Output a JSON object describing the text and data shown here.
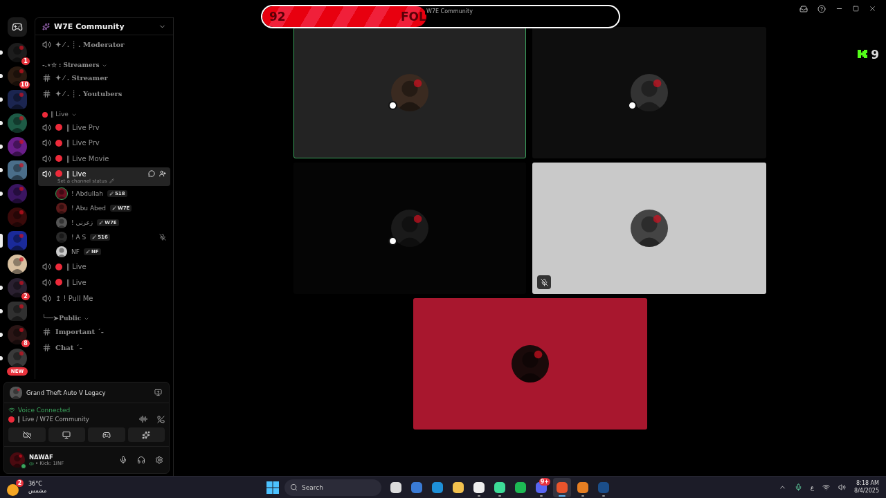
{
  "title_bar": {
    "title": "W7E Community"
  },
  "goal_bar": {
    "count": "92",
    "label": "FOL",
    "level": 0.46
  },
  "kick_overlay": {
    "count": "9"
  },
  "server_rail": {
    "servers": [
      {
        "badge": "1",
        "unread": true,
        "selected": false
      },
      {
        "badge": "10",
        "unread": true,
        "selected": false
      },
      {
        "unread": true,
        "selected": false
      },
      {
        "unread": true,
        "selected": false
      },
      {
        "unread": true,
        "selected": false
      },
      {
        "unread": true,
        "selected": false
      },
      {
        "unread": true,
        "selected": false
      },
      {
        "unread": false,
        "selected": false
      },
      {
        "unread": false,
        "selected": true
      },
      {
        "unread": false,
        "selected": false
      },
      {
        "badge": "2",
        "unread": true,
        "selected": false
      },
      {
        "unread": true,
        "selected": false
      },
      {
        "badge": "8",
        "unread": true,
        "selected": false
      },
      {
        "unread": true,
        "selected": false
      }
    ],
    "new_pill": "NEW"
  },
  "server": {
    "name": "W7E Community"
  },
  "channels": [
    {
      "kind": "voice",
      "name": "✦ ⁄ .  ┊ . Moderator",
      "fancy": true,
      "dot": false,
      "selected": false
    },
    {
      "kind": "category",
      "name": "-.⋆☆ : Streamers",
      "dot": false
    },
    {
      "kind": "text",
      "name": "✦ ⁄ . Streamer",
      "selected": false
    },
    {
      "kind": "text",
      "name": "✦ ⁄ .  ┊ . Youtubers",
      "selected": false
    },
    {
      "kind": "category",
      "name": "‖ Live",
      "dot": true
    },
    {
      "kind": "voice",
      "name": "‖ Live Prv",
      "fancy": false,
      "dot": true,
      "selected": false
    },
    {
      "kind": "voice",
      "name": "‖ Live Prv",
      "fancy": false,
      "dot": true,
      "selected": false
    },
    {
      "kind": "voice",
      "name": "‖ Live Movie",
      "fancy": false,
      "dot": true,
      "selected": false
    },
    {
      "kind": "voice",
      "name": "‖ Live",
      "fancy": false,
      "dot": true,
      "selected": true,
      "status_hint": "Set a channel status"
    },
    {
      "kind": "member",
      "name": "! Abdullah",
      "tag": "518",
      "speaking": true,
      "muted": false
    },
    {
      "kind": "member",
      "name": "! Abu Abed",
      "tag": "W7E",
      "speaking": false,
      "muted": false
    },
    {
      "kind": "member",
      "name": "! زعرني",
      "tag": "W7E",
      "speaking": false,
      "muted": false
    },
    {
      "kind": "member",
      "name": "! A S",
      "tag": "516",
      "speaking": false,
      "muted": true
    },
    {
      "kind": "member",
      "name": "NF",
      "tag": "NF",
      "speaking": false,
      "muted": false
    },
    {
      "kind": "voice",
      "name": "‖ Live",
      "fancy": false,
      "dot": true,
      "selected": false
    },
    {
      "kind": "voice",
      "name": "‖ Live",
      "fancy": false,
      "dot": true,
      "selected": false
    },
    {
      "kind": "voice",
      "name": "↥ ! Pull Me",
      "fancy": false,
      "dot": false,
      "selected": false
    },
    {
      "kind": "category",
      "name": "╰──➤Public",
      "dot": false
    },
    {
      "kind": "text",
      "name": "Important ˊ-",
      "selected": false
    },
    {
      "kind": "text",
      "name": "Chat ˊ-",
      "selected": false
    }
  ],
  "activity": {
    "game": "Grand Theft Auto V Legacy"
  },
  "voice": {
    "status": "Voice Connected",
    "channel": "‖ Live / W7E Community"
  },
  "user": {
    "name": "NAWAF",
    "status": "• Kick: 1INF"
  },
  "tiles": [
    {
      "color": "#232323",
      "speaking": true,
      "muted": false,
      "badge": true
    },
    {
      "color": "#0e0e0e",
      "speaking": false,
      "muted": false,
      "badge": true
    },
    {
      "color": "#050505",
      "speaking": false,
      "muted": false,
      "badge": true
    },
    {
      "color": "#c9c9c9",
      "speaking": false,
      "muted": true,
      "badge": false
    },
    {
      "color": "#a8172e",
      "speaking": false,
      "muted": false,
      "badge": false
    }
  ],
  "taskbar": {
    "weather": {
      "temp": "36°C",
      "condition": "مشمس",
      "badge": "2"
    },
    "search": {
      "placeholder": "Search"
    },
    "apps": [
      {
        "running": false,
        "selected": false
      },
      {
        "running": false,
        "selected": false
      },
      {
        "running": false,
        "selected": false
      },
      {
        "running": false,
        "selected": false
      },
      {
        "running": true,
        "selected": false
      },
      {
        "running": true,
        "selected": false
      },
      {
        "running": false,
        "selected": false
      },
      {
        "running": true,
        "selected": false,
        "badge": "9+"
      },
      {
        "running": true,
        "selected": true
      },
      {
        "running": true,
        "selected": false
      },
      {
        "running": true,
        "selected": false
      }
    ],
    "language": "ع",
    "time": "8:18 AM",
    "date": "8/4/2025"
  }
}
